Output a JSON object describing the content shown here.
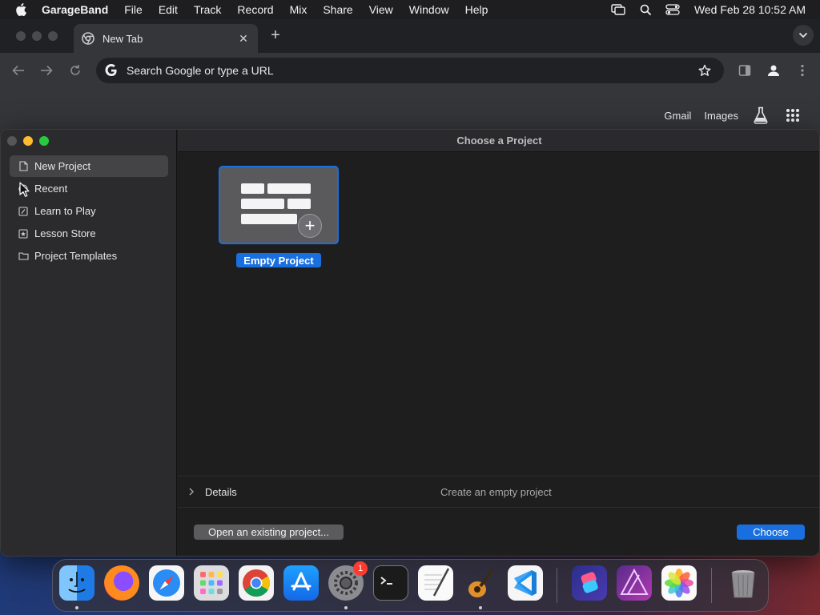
{
  "menubar": {
    "app_name": "GarageBand",
    "items": [
      "File",
      "Edit",
      "Track",
      "Record",
      "Mix",
      "Share",
      "View",
      "Window",
      "Help"
    ],
    "clock": "Wed Feb 28  10:52 AM"
  },
  "browser": {
    "tab_title": "New Tab",
    "omnibox_placeholder": "Search Google or type a URL",
    "ntp_links": {
      "gmail": "Gmail",
      "images": "Images"
    }
  },
  "garageband": {
    "title": "Choose a Project",
    "sidebar": {
      "items": [
        {
          "label": "New Project",
          "icon": "document-icon",
          "selected": true
        },
        {
          "label": "Recent",
          "icon": "clock-icon",
          "selected": false
        },
        {
          "label": "Learn to Play",
          "icon": "guitar-lesson-icon",
          "selected": false
        },
        {
          "label": "Lesson Store",
          "icon": "star-box-icon",
          "selected": false
        },
        {
          "label": "Project Templates",
          "icon": "folder-icon",
          "selected": false
        }
      ]
    },
    "project": {
      "label": "Empty Project"
    },
    "details": {
      "label": "Details",
      "description": "Create an empty project"
    },
    "buttons": {
      "open_existing": "Open an existing project...",
      "choose": "Choose"
    }
  },
  "dock": {
    "apps": [
      "finder-icon",
      "firefox-icon",
      "safari-icon",
      "launchpad-icon",
      "chrome-icon",
      "app-store-icon",
      "system-settings-icon",
      "terminal-icon",
      "textedit-icon",
      "garageband-icon",
      "vscode-icon",
      "shortcuts-icon",
      "affinity-photo-icon",
      "photos-icon",
      "trash-icon"
    ],
    "settings_badge": "1"
  },
  "colors": {
    "accent": "#1a6fe0",
    "menubar": "#1e1e20",
    "chrome_toolbar": "#35363a",
    "sidebar": "#2b2b2d"
  }
}
